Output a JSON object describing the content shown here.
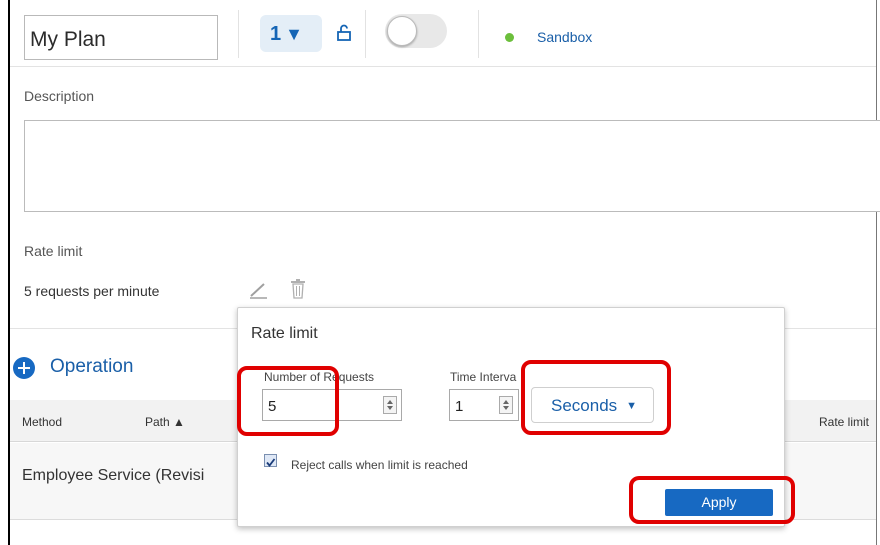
{
  "plan": {
    "name": "My Plan",
    "version": "1",
    "version_arrow": "▼",
    "environment": "Sandbox",
    "environment_color": "#6cbf3c"
  },
  "description": {
    "label": "Description",
    "value": ""
  },
  "rate_limit": {
    "label": "Rate limit",
    "summary": "5 requests per minute"
  },
  "operation": {
    "add_label": "Operation"
  },
  "table": {
    "columns": {
      "method": "Method",
      "path": "Path ▲",
      "rate_limit": "Rate limit"
    },
    "rows": [
      {
        "name": "Employee Service (Revisi"
      }
    ]
  },
  "popup": {
    "title": "Rate limit",
    "requests_label": "Number of Requests",
    "requests_value": "5",
    "interval_label": "Time Interva",
    "interval_value": "1",
    "unit": "Seconds",
    "reject_label": "Reject calls when limit is reached",
    "reject_checked": true,
    "apply_label": "Apply"
  },
  "colors": {
    "accent": "#1769c2",
    "highlight": "#e00000"
  }
}
